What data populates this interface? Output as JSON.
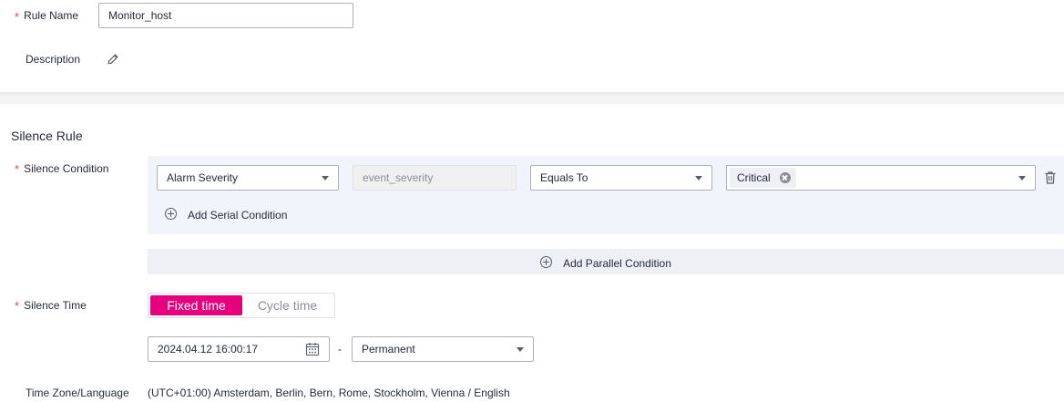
{
  "form": {
    "rule_name_label": "Rule Name",
    "rule_name_value": "Monitor_host",
    "description_label": "Description",
    "required_mark": "*"
  },
  "silence_rule": {
    "section_title": "Silence Rule",
    "condition_label": "Silence Condition",
    "condition": {
      "field_select": "Alarm Severity",
      "field_key": "event_severity",
      "operator_select": "Equals To",
      "value_tags": [
        "Critical"
      ]
    },
    "add_serial_label": "Add Serial Condition",
    "add_parallel_label": "Add Parallel Condition",
    "time_label": "Silence Time",
    "time_modes": [
      "Fixed time",
      "Cycle time"
    ],
    "time_mode_selected": "Fixed time",
    "start_datetime": "2024.04.12 16:00:17",
    "range_separator": "-",
    "end_select": "Permanent",
    "timezone_label": "Time Zone/Language",
    "timezone_value": "(UTC+01:00) Amsterdam, Berlin, Bern, Rome, Stockholm, Vienna / English"
  },
  "colors": {
    "accent": "#e6007e",
    "required": "#e6435e",
    "panel_bg": "#f1f4fa"
  },
  "icons": {
    "description_edit": "pencil-icon",
    "delete_condition": "trash-icon",
    "add_serial": "plus-circle-icon",
    "add_parallel": "plus-circle-icon",
    "calendar": "calendar-icon"
  }
}
